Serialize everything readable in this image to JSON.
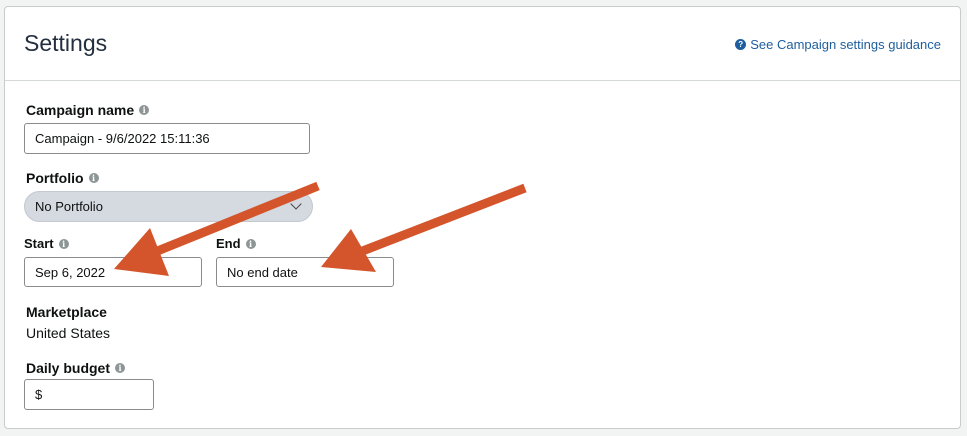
{
  "header": {
    "title": "Settings",
    "guidance_link": "See Campaign settings guidance"
  },
  "campaign_name": {
    "label": "Campaign name",
    "value": "Campaign - 9/6/2022 15:11:36"
  },
  "portfolio": {
    "label": "Portfolio",
    "selected": "No Portfolio"
  },
  "start": {
    "label": "Start",
    "value": "Sep 6, 2022"
  },
  "end": {
    "label": "End",
    "value": "No end date"
  },
  "marketplace": {
    "label": "Marketplace",
    "value": "United States"
  },
  "daily_budget": {
    "label": "Daily budget",
    "currency": "$"
  },
  "info_icon_glyph": "i",
  "help_icon_glyph": "?",
  "colors": {
    "link": "#1f5e9c",
    "annotation_arrow": "#d4552b",
    "portfolio_select_bg": "#d5d9e0"
  }
}
